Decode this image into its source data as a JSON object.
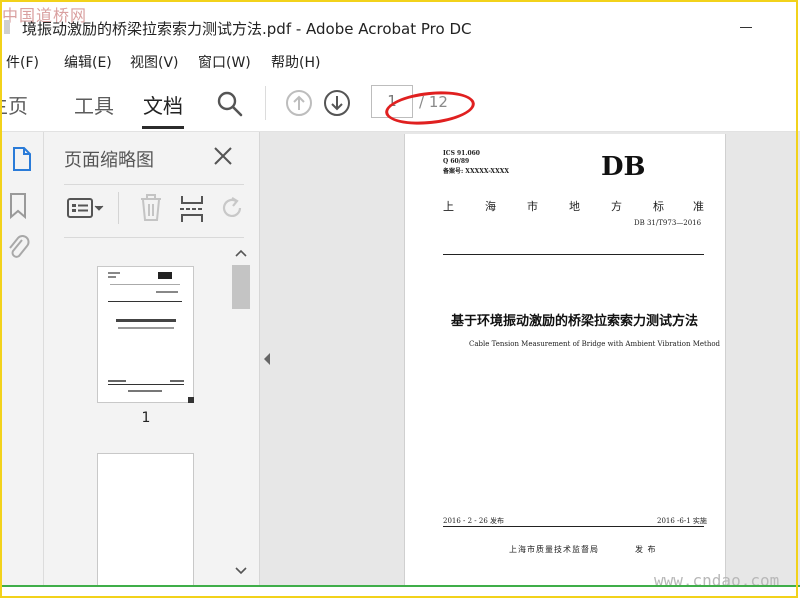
{
  "window": {
    "title": "境振动激励的桥梁拉索索力测试方法.pdf - Adobe Acrobat Pro DC",
    "watermark_top": "中国道桥网",
    "watermark_bottom": "www.cndao.com",
    "minimize_icon": "minimize-icon"
  },
  "menu": {
    "items": [
      {
        "label": "文件(F)",
        "visible_label": "文件(F)"
      },
      {
        "label": "编辑(E)"
      },
      {
        "label": "视图(V)"
      },
      {
        "label": "窗口(W)"
      },
      {
        "label": "帮助(H)"
      }
    ],
    "first_visible": "件(F)"
  },
  "toolbar": {
    "tabs": [
      {
        "label": "主页",
        "visible": "主页"
      },
      {
        "label": "工具"
      },
      {
        "label": "文档",
        "active": true
      }
    ],
    "home_visible": "主页",
    "search_icon": "search-icon",
    "prev_page_icon": "arrow-up-circle-icon",
    "next_page_icon": "arrow-down-circle-icon",
    "current_page": "1",
    "total_pages": "/ 12",
    "annotation_color": "#e02020"
  },
  "sidebar_rail": {
    "icons": [
      "page-thumbnails-icon",
      "bookmark-icon",
      "attachment-icon"
    ],
    "active_color": "#2a7bd8"
  },
  "thumbnail_panel": {
    "title": "页面缩略图",
    "close_icon": "close-icon",
    "tools": [
      "thumbnail-options-icon",
      "delete-icon",
      "insert-page-icon",
      "rotate-icon"
    ],
    "pages": [
      {
        "label": "1"
      },
      {
        "label": ""
      }
    ]
  },
  "document_page": {
    "ics": "ICS 91.060",
    "class_code": "Q 60/89",
    "record_no": "备案号: XXXXX-XXXX",
    "db_mark": "DB",
    "standard_chars": [
      "上",
      "海",
      "市",
      "地",
      "方",
      "标",
      "准"
    ],
    "std_number": "DB 31/T973—2016",
    "title_cn": "基于环境振动激励的桥梁拉索索力测试方法",
    "title_en": "Cable Tension Measurement of Bridge with Ambient Vibration Method",
    "issue_date": "2016 - 2 - 26 发布",
    "impl_date": "2016 -6-1 实施",
    "issuer": "上海市质量技术监督局",
    "issue_word": "发 布"
  },
  "colors": {
    "border_frame": "#f2d21b",
    "bottom_line": "#3fae49",
    "doc_bg": "#e7e7e7"
  }
}
